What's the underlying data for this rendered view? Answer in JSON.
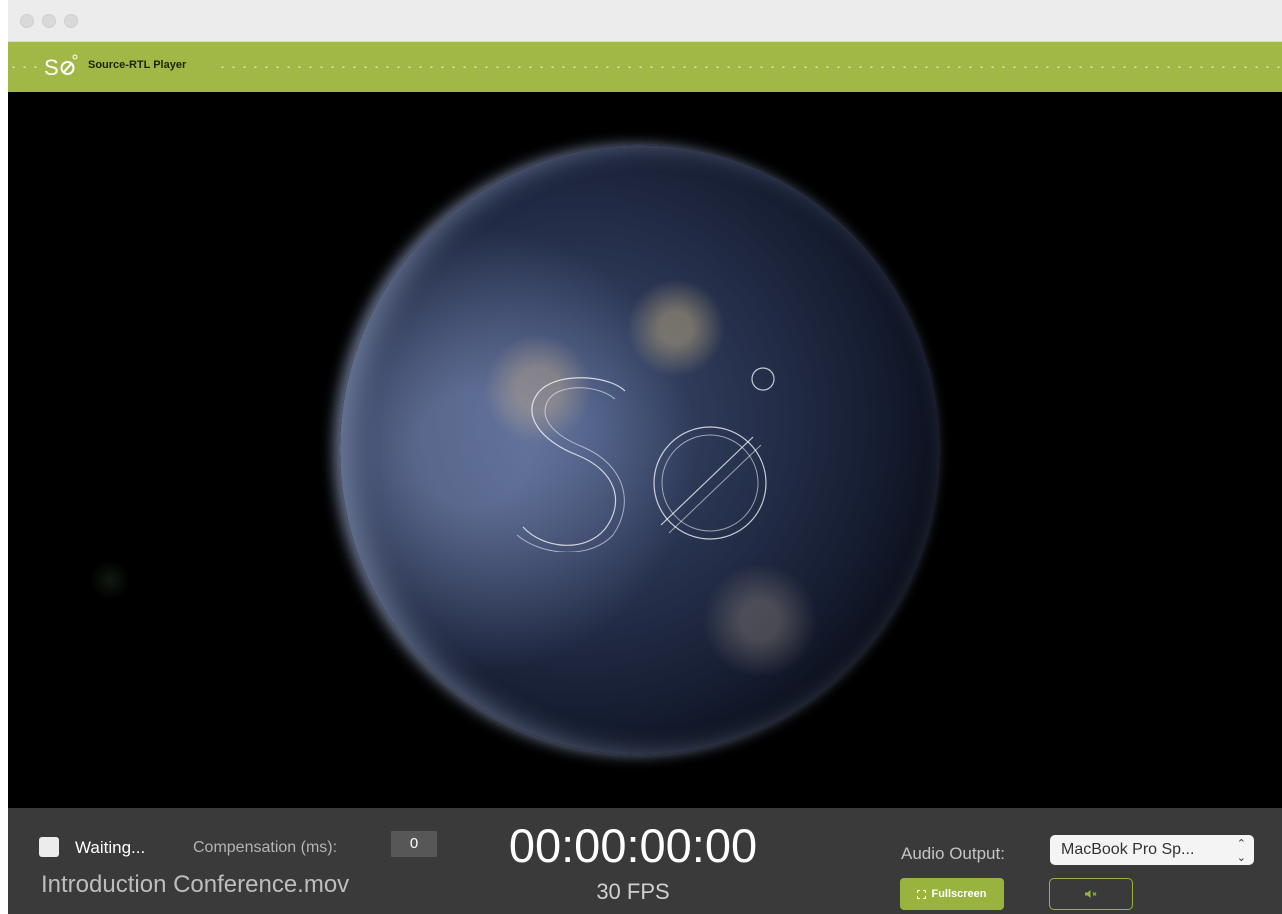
{
  "window": {
    "traffic_lights": [
      "close",
      "minimize",
      "zoom"
    ]
  },
  "brand": {
    "name": "Source-RTL Player",
    "logo_text": "Sø",
    "color": "#a1b847"
  },
  "video": {
    "content": "earth-at-night",
    "watermark": "Sø"
  },
  "controls": {
    "status_label": "Waiting...",
    "compensation_label": "Compensation (ms):",
    "compensation_value": "0",
    "file_name": "Introduction Conference.mov",
    "timecode": "00:00:00:00",
    "fps": "30 FPS",
    "audio_output_label": "Audio Output:",
    "audio_output_value": "MacBook Pro Sp...",
    "fullscreen_label": "Fullscreen",
    "mute_icon": "speaker-muted-icon",
    "accent_color": "#98b33e"
  }
}
